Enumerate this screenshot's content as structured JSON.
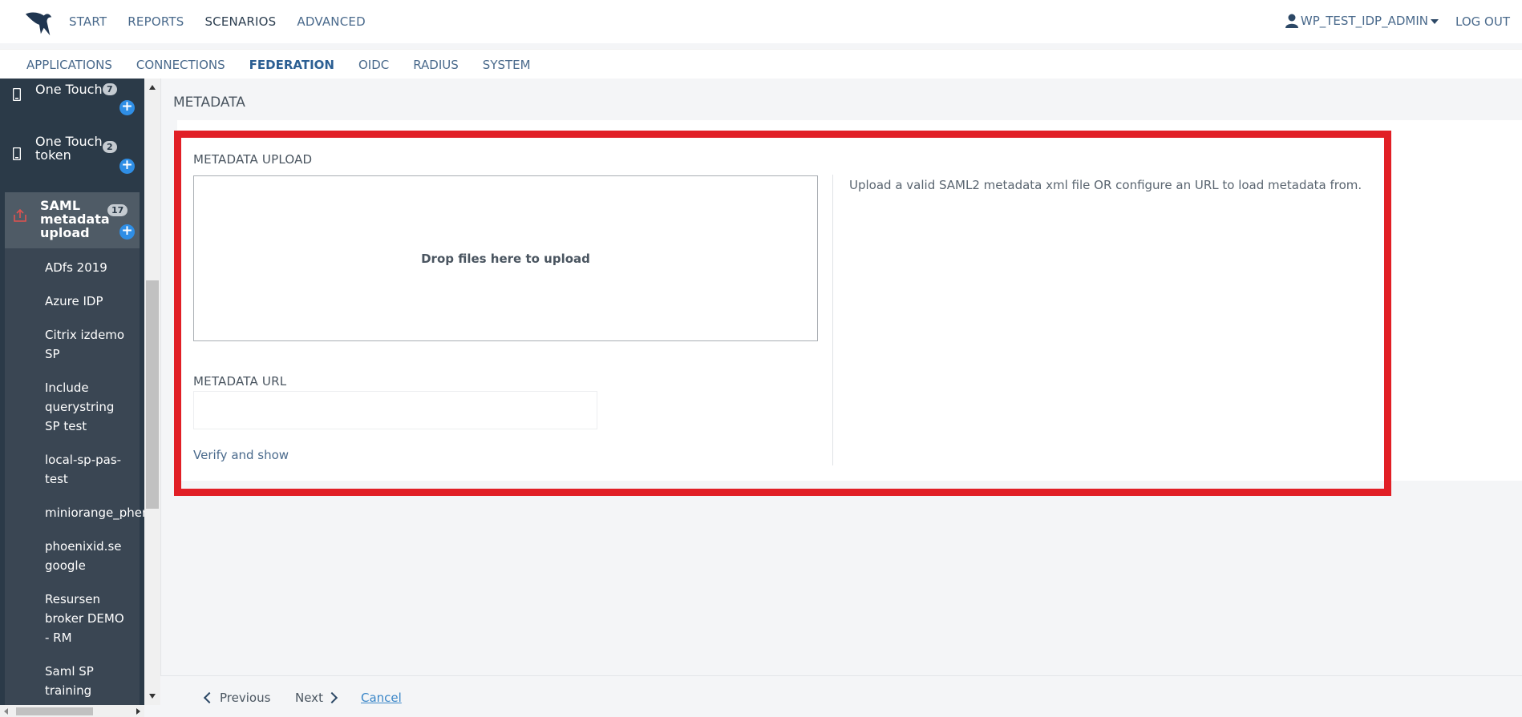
{
  "topnav": {
    "items": [
      "START",
      "REPORTS",
      "SCENARIOS",
      "ADVANCED"
    ],
    "active": "SCENARIOS",
    "user": "WP_TEST_IDP_ADMIN",
    "logout": "LOG OUT"
  },
  "subnav": {
    "items": [
      "APPLICATIONS",
      "CONNECTIONS",
      "FEDERATION",
      "OIDC",
      "RADIUS",
      "SYSTEM"
    ],
    "active": "FEDERATION"
  },
  "sidebar": {
    "groups": [
      {
        "label": "One Touch",
        "count": "7",
        "icon": "mobile-icon"
      },
      {
        "label": "One Touch token",
        "count": "2",
        "icon": "mobile-icon"
      },
      {
        "label": "SAML metadata upload",
        "count": "17",
        "icon": "upload-icon"
      }
    ],
    "items": [
      "ADfs 2019",
      "Azure IDP",
      "Citrix izdemo SP",
      "Include querystring SP test",
      "local-sp-pas-test",
      "miniorange_phen",
      "phoenixid.se google",
      "Resursen broker DEMO - RM",
      "Saml SP training"
    ]
  },
  "main": {
    "title": "METADATA",
    "upload_label": "METADATA UPLOAD",
    "dropzone_text": "Drop files here to upload",
    "url_label": "METADATA URL",
    "url_value": "",
    "verify_link": "Verify and show",
    "help_text": "Upload a valid SAML2 metadata xml file OR configure an URL to load metadata from."
  },
  "footer": {
    "previous": "Previous",
    "next": "Next",
    "cancel": "Cancel"
  },
  "colors": {
    "highlight": "#e11f26",
    "sidebar_bg": "#3a4653",
    "accent_blue": "#2f8ee5"
  }
}
